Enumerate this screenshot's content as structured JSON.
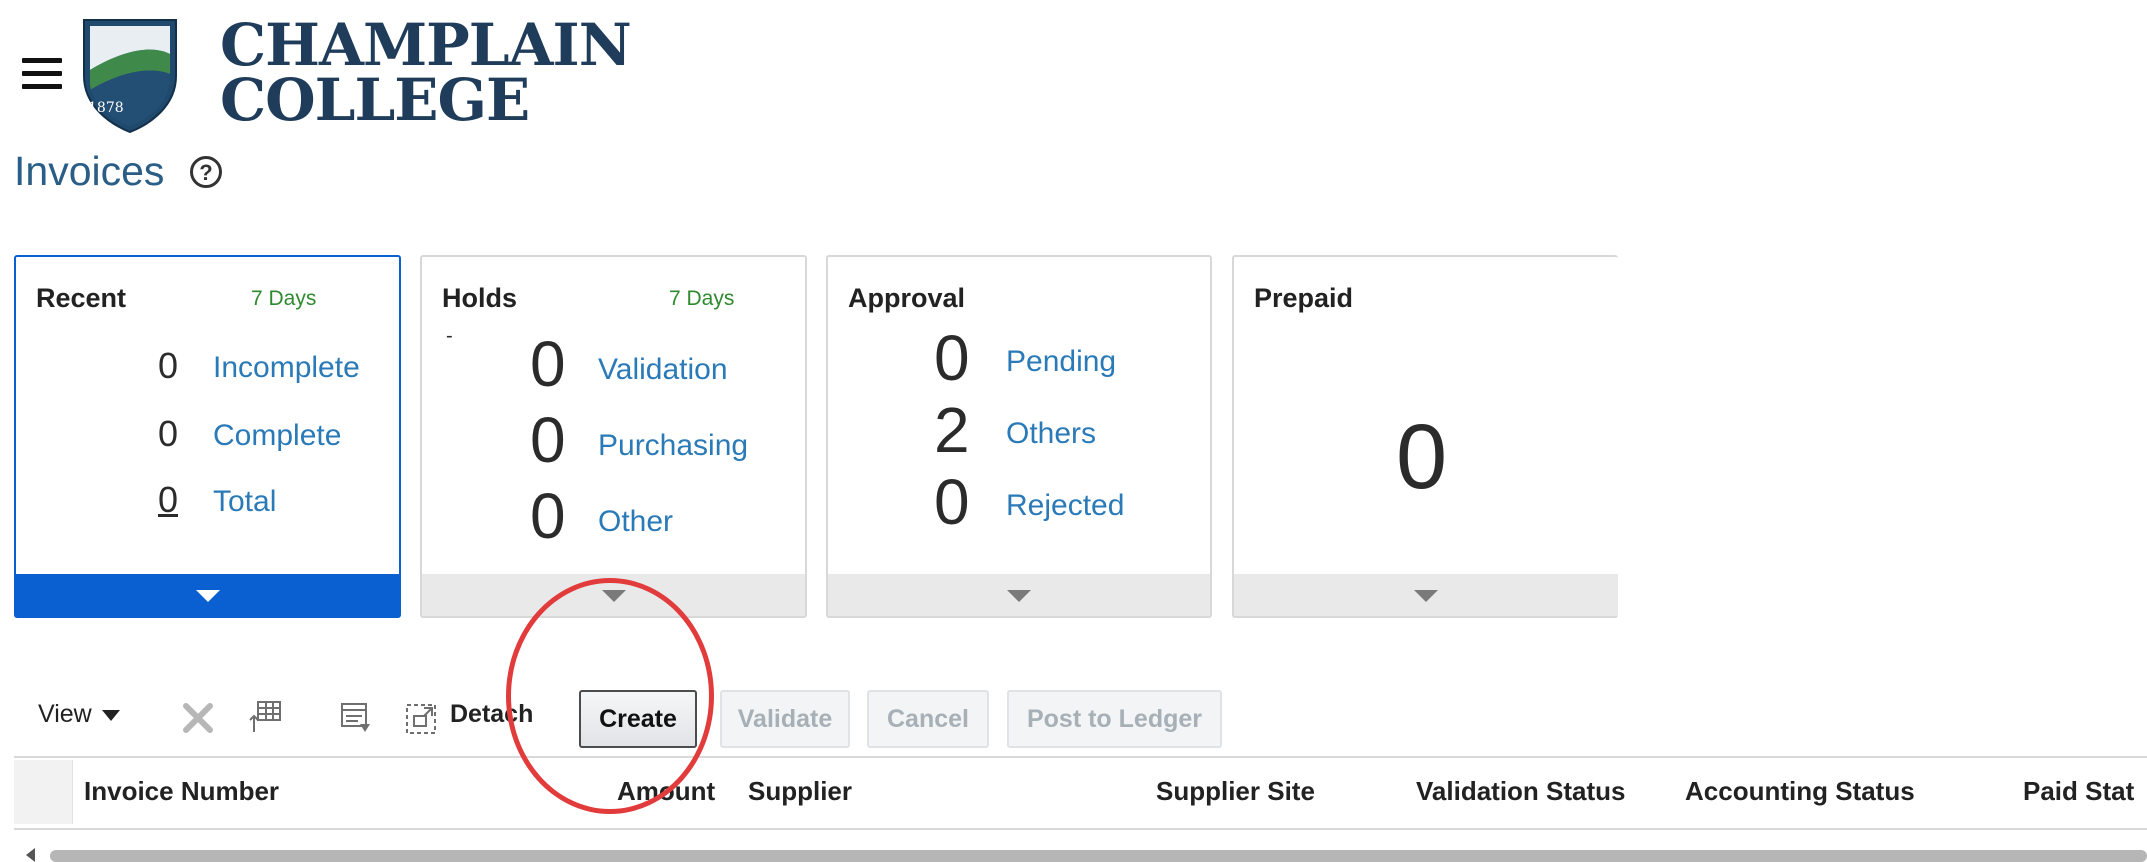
{
  "header": {
    "logo_line1": "CHAMPLAIN",
    "logo_line2": "COLLEGE",
    "logo_year": "1878",
    "page_title": "Invoices",
    "help_glyph": "?"
  },
  "cards": {
    "recent": {
      "title": "Recent",
      "period": "7 Days",
      "rows": [
        {
          "value": "0",
          "label": "Incomplete"
        },
        {
          "value": "0",
          "label": "Complete"
        },
        {
          "value": "0",
          "label": "Total"
        }
      ]
    },
    "holds": {
      "title": "Holds",
      "period": "7 Days",
      "dash": "-",
      "rows": [
        {
          "value": "0",
          "label": "Validation"
        },
        {
          "value": "0",
          "label": "Purchasing"
        },
        {
          "value": "0",
          "label": "Other"
        }
      ]
    },
    "approval": {
      "title": "Approval",
      "rows": [
        {
          "value": "0",
          "label": "Pending"
        },
        {
          "value": "2",
          "label": "Others"
        },
        {
          "value": "0",
          "label": "Rejected"
        }
      ]
    },
    "prepaid": {
      "title": "Prepaid",
      "value": "0"
    }
  },
  "toolbar": {
    "view_label": "View",
    "detach_label": "Detach",
    "create_label": "Create",
    "validate_label": "Validate",
    "cancel_label": "Cancel",
    "post_label": "Post to Ledger"
  },
  "table": {
    "columns": [
      "Invoice Number",
      "Amount",
      "Supplier",
      "Supplier Site",
      "Validation Status",
      "Accounting Status",
      "Paid Stat"
    ]
  },
  "colors": {
    "accent_blue": "#0a5fd1",
    "link_blue": "#2a7ab8",
    "period_green": "#2f8a2f",
    "annotation_red": "#e23b3b",
    "logo_navy": "#1f3c5a"
  },
  "icons": {
    "menu": "hamburger-menu-icon",
    "help": "help-circle-icon",
    "delete": "delete-x-icon",
    "freeze": "freeze-columns-icon",
    "wrap": "wrap-icon",
    "detach": "detach-icon",
    "card_expand": "triangle-down-icon"
  }
}
